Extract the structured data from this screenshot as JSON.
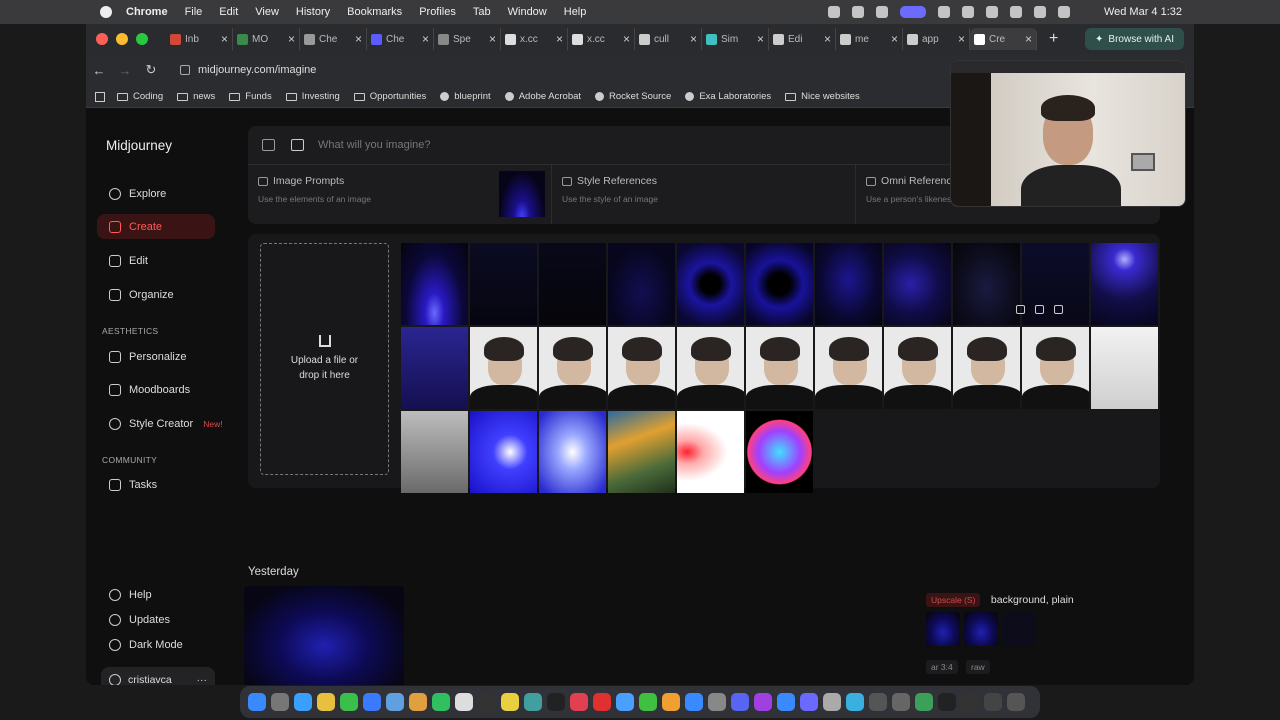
{
  "menubar": {
    "app": "Chrome",
    "items": [
      "File",
      "Edit",
      "View",
      "History",
      "Bookmarks",
      "Profiles",
      "Tab",
      "Window",
      "Help"
    ],
    "clock": "Wed Mar 4  1:32"
  },
  "tabs": [
    {
      "label": "Inb",
      "color": "#d44638"
    },
    {
      "label": "MO",
      "color": "#3a8a4a"
    },
    {
      "label": "Che",
      "color": "#999999"
    },
    {
      "label": "Che",
      "color": "#5b5bff"
    },
    {
      "label": "Spe",
      "color": "#888888"
    },
    {
      "label": "x.cc",
      "color": "#dddddd"
    },
    {
      "label": "x.cc",
      "color": "#dddddd"
    },
    {
      "label": "cull",
      "color": "#cccccc"
    },
    {
      "label": "Sim",
      "color": "#3fbfbf"
    },
    {
      "label": "Edi",
      "color": "#cccccc"
    },
    {
      "label": "me",
      "color": "#cccccc"
    },
    {
      "label": "app",
      "color": "#cccccc"
    },
    {
      "label": "Cre",
      "color": "#ffffff",
      "active": true
    }
  ],
  "browse_ai": "Browse with AI",
  "url": "midjourney.com/imagine",
  "bookmarks": [
    {
      "label": "Coding",
      "icon": "folder"
    },
    {
      "label": "news",
      "icon": "folder"
    },
    {
      "label": "Funds",
      "icon": "folder"
    },
    {
      "label": "Investing",
      "icon": "folder"
    },
    {
      "label": "Opportunities",
      "icon": "folder"
    },
    {
      "label": "blueprint",
      "icon": "site"
    },
    {
      "label": "Adobe Acrobat",
      "icon": "site"
    },
    {
      "label": "Rocket Source",
      "icon": "site"
    },
    {
      "label": "Exa Laboratories",
      "icon": "site"
    },
    {
      "label": "Nice websites",
      "icon": "folder"
    }
  ],
  "sidebar": {
    "brand": "Midjourney",
    "items": [
      {
        "label": "Explore",
        "icon": "compass-icon"
      },
      {
        "label": "Create",
        "icon": "create-icon",
        "active": true
      },
      {
        "label": "Edit",
        "icon": "edit-icon"
      },
      {
        "label": "Organize",
        "icon": "organize-icon"
      }
    ],
    "aesthetics_heading": "AESTHETICS",
    "aesthetics": [
      {
        "label": "Personalize",
        "icon": "personalize-icon"
      },
      {
        "label": "Moodboards",
        "icon": "moodboards-icon"
      },
      {
        "label": "Style Creator",
        "icon": "style-creator-icon",
        "badge": "New!"
      }
    ],
    "community_heading": "COMMUNITY",
    "community": [
      {
        "label": "Tasks",
        "icon": "thumbs-up-icon"
      }
    ],
    "footer": [
      {
        "label": "Help",
        "icon": "help-icon"
      },
      {
        "label": "Updates",
        "icon": "bell-icon"
      },
      {
        "label": "Dark Mode",
        "icon": "moon-icon"
      }
    ],
    "user": "cristiavca",
    "user_more": "···"
  },
  "prompt": {
    "placeholder": "What will you imagine?"
  },
  "refs": [
    {
      "title": "Image Prompts",
      "subtitle": "Use the elements of an image"
    },
    {
      "title": "Style References",
      "subtitle": "Use the style of an image"
    },
    {
      "title": "Omni Reference",
      "subtitle": "Use a person's likeness"
    }
  ],
  "upload": {
    "text_line1": "Upload a file or",
    "text_line2": "drop it here"
  },
  "tiles": [
    {
      "kind": "blue",
      "bg": "radial-gradient(ellipse at 50% 85%,#6a6aff 0%,#2a19c4 20%,#0b0838 60%,#05040f 100%)"
    },
    {
      "kind": "blue",
      "bg": "linear-gradient(180deg,#0b0b22,#060611)"
    },
    {
      "kind": "blue",
      "bg": "linear-gradient(180deg,#08081a,#050509)"
    },
    {
      "kind": "blue",
      "bg": "radial-gradient(ellipse at 50% 60%,#120e52 0%,#07061c 70%)"
    },
    {
      "kind": "blue",
      "bg": "radial-gradient(circle at 50% 50%,#000 0%,#000 18%,#1b14a0 40%,#0a0830 80%)"
    },
    {
      "kind": "blue",
      "bg": "radial-gradient(circle at 50% 50%,#000 0%,#000 20%,#18129a 45%,#080628 85%)"
    },
    {
      "kind": "blue",
      "bg": "radial-gradient(ellipse at 50% 45%,#1c1690 0%,#0a0830 60%,#050510 100%)"
    },
    {
      "kind": "blue",
      "bg": "radial-gradient(ellipse at 40% 50%,#2a20a8 0%,#100c48 50%,#060612 100%)"
    },
    {
      "kind": "blue",
      "bg": "radial-gradient(ellipse at 50% 55%,#1a1a40 0%,#0c0c1c 60%,#050508 100%)"
    },
    {
      "kind": "blue",
      "bg": "linear-gradient(180deg,#0c0c2a,#080816)"
    },
    {
      "kind": "blue",
      "bg": "radial-gradient(circle at 50% 20%,#b0b0ff 0%,#3a2ad0 15%,#120e48 55%,#07061a 100%)"
    },
    {
      "kind": "blue",
      "bg": "linear-gradient(180deg,#2a2590,#151050)"
    },
    {
      "kind": "portrait"
    },
    {
      "kind": "portrait"
    },
    {
      "kind": "portrait"
    },
    {
      "kind": "portrait"
    },
    {
      "kind": "portrait"
    },
    {
      "kind": "portrait"
    },
    {
      "kind": "portrait"
    },
    {
      "kind": "portrait"
    },
    {
      "kind": "portrait"
    },
    {
      "kind": "blue",
      "bg": "linear-gradient(180deg,#f2f2f2,#cfcfcf)"
    },
    {
      "kind": "blue",
      "bg": "linear-gradient(180deg,#bdbdbd,#6a6a6a)"
    },
    {
      "kind": "blue",
      "bg": "radial-gradient(ellipse at 60% 50%,#ffffff 0%,#4040ff 30%,#1a10c8 100%)"
    },
    {
      "kind": "blue",
      "bg": "radial-gradient(ellipse at 50% 50%,#ffffff 0%,#9aa8ff 30%,#2a2ad0 90%)"
    },
    {
      "kind": "blue",
      "bg": "linear-gradient(160deg,#2a6aa0 0%,#e0a030 35%,#4a6a3a 70%,#20301a 100%)"
    },
    {
      "kind": "blue",
      "bg": "radial-gradient(ellipse at 15% 50%,#ff2030 0%,#ffaaaa 20%,#ffffff 50%,#ffffff 100%)"
    },
    {
      "kind": "blue",
      "bg": "radial-gradient(circle at 50% 50%,#40e0ff 0%,#a040ff 40%,#ff4080 60%,#000 62%)"
    }
  ],
  "yesterday": "Yesterday",
  "job": {
    "badge": "Upscale (S)",
    "title": "background, plain",
    "tags": [
      "ar 3:4",
      "raw"
    ]
  }
}
